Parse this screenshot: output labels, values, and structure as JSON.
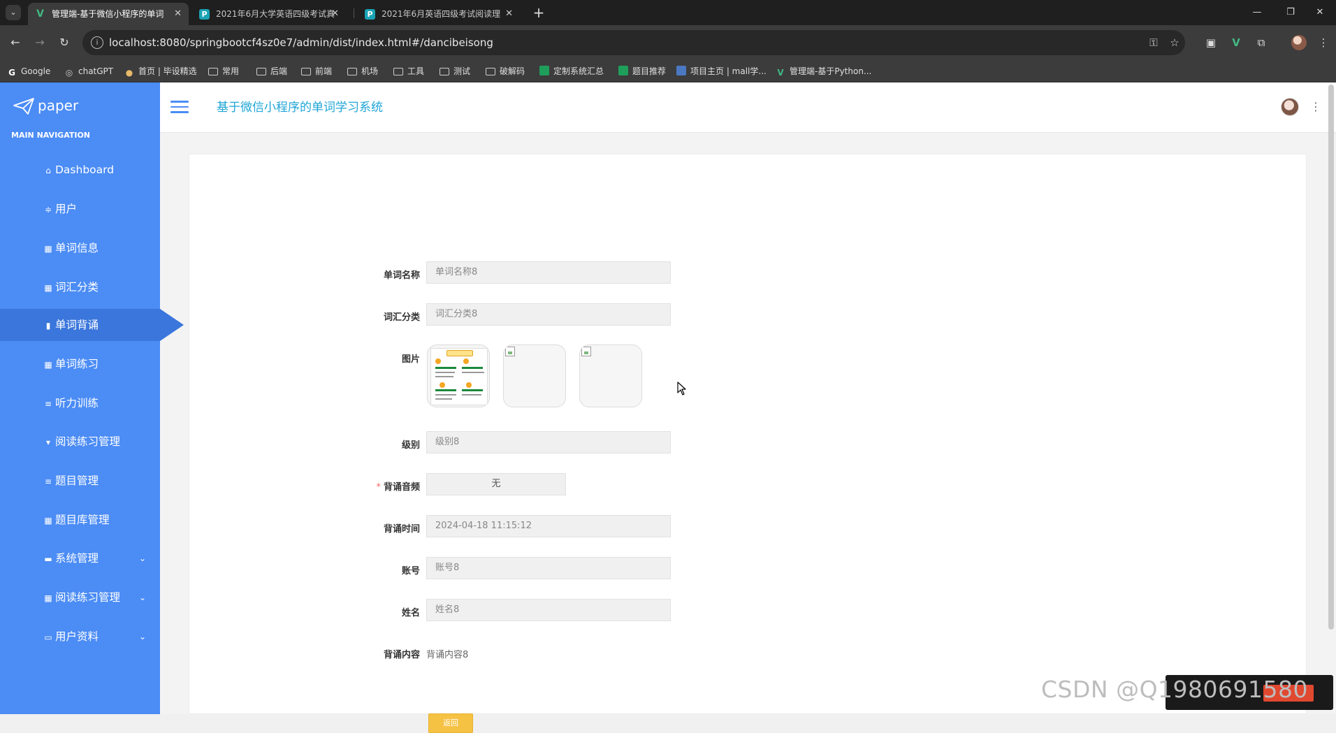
{
  "browser": {
    "tabs": [
      {
        "title": "管理端-基于微信小程序的单词",
        "active": true,
        "icon": "vue-icon"
      },
      {
        "title": "2021年6月大学英语四级考试真",
        "active": false,
        "icon": "page-icon"
      },
      {
        "title": "2021年6月英语四级考试阅读理",
        "active": false,
        "icon": "page-icon"
      }
    ],
    "url": "localhost:8080/springbootcf4sz0e7/admin/dist/index.html#/dancibeisong",
    "bookmarks": [
      {
        "label": "Google",
        "icon": "google-icon"
      },
      {
        "label": "chatGPT",
        "icon": "chatgpt-icon"
      },
      {
        "label": "首页 | 毕设精选",
        "icon": "site-icon"
      },
      {
        "label": "常用",
        "icon": "folder-icon"
      },
      {
        "label": "后端",
        "icon": "folder-icon"
      },
      {
        "label": "前端",
        "icon": "folder-icon"
      },
      {
        "label": "机场",
        "icon": "folder-icon"
      },
      {
        "label": "工具",
        "icon": "folder-icon"
      },
      {
        "label": "测试",
        "icon": "folder-icon"
      },
      {
        "label": "破解码",
        "icon": "folder-icon"
      },
      {
        "label": "定制系统汇总",
        "icon": "sheet-icon"
      },
      {
        "label": "题目推荐",
        "icon": "sheet-icon"
      },
      {
        "label": "项目主页 | mall学...",
        "icon": "site-icon"
      },
      {
        "label": "管理端-基于Python...",
        "icon": "vue-icon"
      }
    ]
  },
  "sidebar": {
    "logo": "paper",
    "section": "MAIN NAVIGATION",
    "items": [
      {
        "label": "Dashboard",
        "icon": "home-icon"
      },
      {
        "label": "用户",
        "icon": "sliders-icon"
      },
      {
        "label": "单词信息",
        "icon": "grid-icon"
      },
      {
        "label": "词汇分类",
        "icon": "grid-icon"
      },
      {
        "label": "单词背诵",
        "icon": "bar-chart-icon",
        "active": true
      },
      {
        "label": "单词练习",
        "icon": "grid-icon"
      },
      {
        "label": "听力训练",
        "icon": "list-icon"
      },
      {
        "label": "阅读练习管理",
        "icon": "pin-icon"
      },
      {
        "label": "题目管理",
        "icon": "list-icon"
      },
      {
        "label": "题目库管理",
        "icon": "grid-icon"
      },
      {
        "label": "系统管理",
        "icon": "monitor-icon",
        "expandable": true
      },
      {
        "label": "阅读练习管理",
        "icon": "grid-icon",
        "expandable": true
      },
      {
        "label": "用户资料",
        "icon": "calendar-icon",
        "expandable": true
      }
    ]
  },
  "header": {
    "title": "基于微信小程序的单词学习系统"
  },
  "form": {
    "word_name": {
      "label": "单词名称",
      "value": "单词名称8"
    },
    "category": {
      "label": "词汇分类",
      "value": "词汇分类8"
    },
    "image": {
      "label": "图片"
    },
    "level": {
      "label": "级别",
      "value": "级别8"
    },
    "audio": {
      "label": "背诵音频",
      "value": "无",
      "required": true
    },
    "time": {
      "label": "背诵时间",
      "value": "2024-04-18 11:15:12"
    },
    "account": {
      "label": "账号",
      "value": "账号8"
    },
    "name": {
      "label": "姓名",
      "value": "姓名8"
    },
    "content": {
      "label": "背诵内容",
      "value": "背诵内容8"
    },
    "back_button": "返回"
  },
  "watermark": "CSDN @Q1980691580",
  "colors": {
    "sidebar": "#4b8cf5",
    "title": "#1ea5d6",
    "back_button": "#f6c244"
  }
}
